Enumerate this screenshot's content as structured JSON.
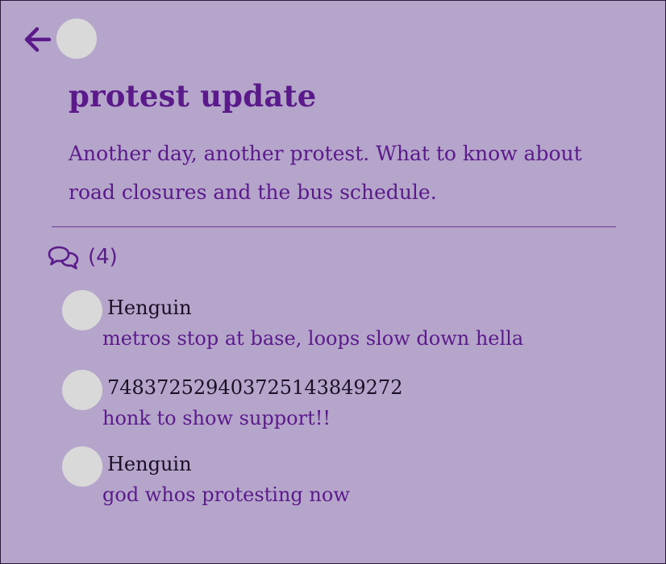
{
  "post": {
    "title": "protest update",
    "summary": "Another day, another protest. What to know about road closures and the bus schedule."
  },
  "comments": {
    "count_label": "(4)",
    "items": [
      {
        "username": "Henguin",
        "text": "metros stop at base, loops slow down hella"
      },
      {
        "username": "748372529403725143849272",
        "text": "honk to show support!!"
      },
      {
        "username": "Henguin",
        "text": "god whos protesting now"
      }
    ]
  },
  "icons": {
    "back": "arrow-left-icon",
    "comments": "speech-bubbles-icon"
  },
  "colors": {
    "background": "#b6a5cb",
    "accent": "#5a1a8a",
    "avatar": "#d9d9d9",
    "username": "#1a0f25"
  }
}
